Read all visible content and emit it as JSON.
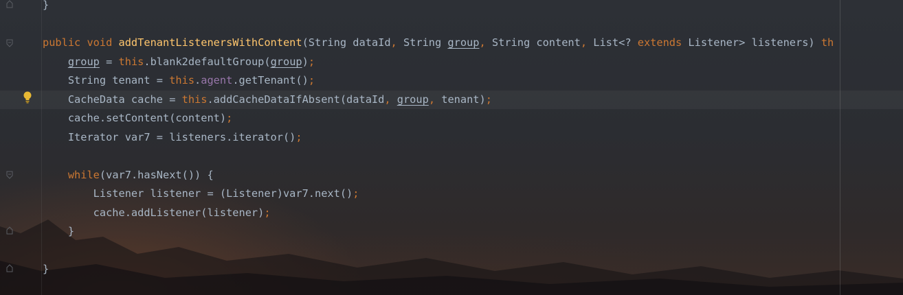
{
  "editor": {
    "lines": [
      {
        "segments": [
          {
            "t": "}",
            "c": "plain"
          }
        ]
      },
      {
        "segments": [
          {
            "t": "public void ",
            "c": "kw"
          },
          {
            "t": "addTenantListenersWithContent",
            "c": "fn"
          },
          {
            "t": "(String dataId",
            "c": "plain"
          },
          {
            "t": ", ",
            "c": "kw"
          },
          {
            "t": "String ",
            "c": "plain"
          },
          {
            "t": "group",
            "c": "u"
          },
          {
            "t": ", ",
            "c": "kw"
          },
          {
            "t": "String content",
            "c": "plain"
          },
          {
            "t": ", ",
            "c": "kw"
          },
          {
            "t": "List<? ",
            "c": "plain"
          },
          {
            "t": "extends ",
            "c": "kw"
          },
          {
            "t": "Listener> listeners) ",
            "c": "plain"
          },
          {
            "t": "th",
            "c": "kw"
          }
        ]
      },
      {
        "segments": [
          {
            "t": "    ",
            "c": "plain"
          },
          {
            "t": "group",
            "c": "u"
          },
          {
            "t": " = ",
            "c": "plain"
          },
          {
            "t": "this",
            "c": "kw"
          },
          {
            "t": ".blank2defaultGroup(",
            "c": "plain"
          },
          {
            "t": "group",
            "c": "u"
          },
          {
            "t": ")",
            "c": "plain"
          },
          {
            "t": ";",
            "c": "kw"
          }
        ]
      },
      {
        "segments": [
          {
            "t": "    String tenant = ",
            "c": "plain"
          },
          {
            "t": "this",
            "c": "kw"
          },
          {
            "t": ".",
            "c": "plain"
          },
          {
            "t": "agent",
            "c": "fld"
          },
          {
            "t": ".getTenant()",
            "c": "plain"
          },
          {
            "t": ";",
            "c": "kw"
          }
        ]
      },
      {
        "segments": [
          {
            "t": "    CacheData cache = ",
            "c": "plain"
          },
          {
            "t": "this",
            "c": "kw"
          },
          {
            "t": ".addCacheDataIfAbsent(dataId",
            "c": "plain"
          },
          {
            "t": ", ",
            "c": "kw"
          },
          {
            "t": "group",
            "c": "u"
          },
          {
            "t": ", ",
            "c": "kw"
          },
          {
            "t": "tenant)",
            "c": "plain"
          },
          {
            "t": ";",
            "c": "kw"
          }
        ]
      },
      {
        "segments": [
          {
            "t": "    cache.setContent(content)",
            "c": "plain"
          },
          {
            "t": ";",
            "c": "kw"
          }
        ]
      },
      {
        "segments": [
          {
            "t": "    Iterator var7 = listeners.iterator()",
            "c": "plain"
          },
          {
            "t": ";",
            "c": "kw"
          }
        ]
      },
      {
        "segments": []
      },
      {
        "segments": [
          {
            "t": "    ",
            "c": "plain"
          },
          {
            "t": "while",
            "c": "kw"
          },
          {
            "t": "(var7.hasNext()) {",
            "c": "plain"
          }
        ]
      },
      {
        "segments": [
          {
            "t": "        Listener listener = (Listener)var7.next()",
            "c": "plain"
          },
          {
            "t": ";",
            "c": "kw"
          }
        ]
      },
      {
        "segments": [
          {
            "t": "        cache.addListener(listener)",
            "c": "plain"
          },
          {
            "t": ";",
            "c": "kw"
          }
        ]
      },
      {
        "segments": [
          {
            "t": "    }",
            "c": "plain"
          }
        ]
      },
      {
        "segments": []
      },
      {
        "segments": [
          {
            "t": "}",
            "c": "plain"
          }
        ]
      }
    ]
  },
  "gutter": {
    "icons": [
      "fold-end-icon",
      "fold-start-icon",
      "fold-start-icon",
      "fold-end-icon",
      "fold-end-icon"
    ],
    "intention_icon": "lightbulb-icon"
  },
  "colors": {
    "keyword": "#cc7832",
    "function_decl": "#ffc66d",
    "field": "#9876aa",
    "plain": "#a9b7c6",
    "bulb": "#e8b934"
  }
}
